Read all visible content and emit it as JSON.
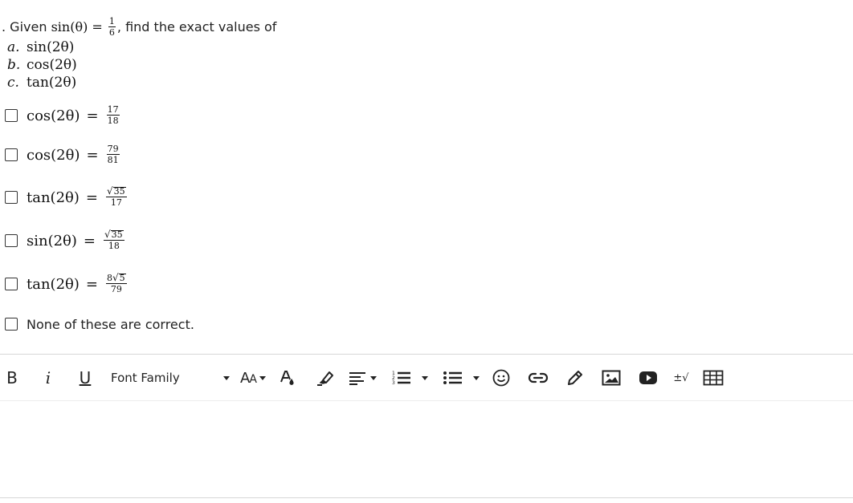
{
  "question": {
    "prefix": ". Given",
    "given_lhs": "sin(θ)",
    "given_eq": "=",
    "given_num": "1",
    "given_den": "6",
    "suffix": ", find the exact values of",
    "parts": [
      {
        "label": "a.",
        "expr": "sin(2θ)"
      },
      {
        "label": "b.",
        "expr": "cos(2θ)"
      },
      {
        "label": "c.",
        "expr": "tan(2θ)"
      }
    ]
  },
  "options": [
    {
      "lhs": "cos(2θ)",
      "eq": "=",
      "num_coef": "",
      "num_rad": "",
      "num": "17",
      "den": "18"
    },
    {
      "lhs": "cos(2θ)",
      "eq": "=",
      "num_coef": "",
      "num_rad": "",
      "num": "79",
      "den": "81"
    },
    {
      "lhs": "tan(2θ)",
      "eq": "=",
      "num_coef": "",
      "num_rad": "35",
      "num": "",
      "den": "17"
    },
    {
      "lhs": "sin(2θ)",
      "eq": "=",
      "num_coef": "",
      "num_rad": "35",
      "num": "",
      "den": "18"
    },
    {
      "lhs": "tan(2θ)",
      "eq": "=",
      "num_coef": "8",
      "num_rad": "5",
      "num": "",
      "den": "79"
    },
    {
      "text": "None of these are correct."
    }
  ],
  "toolbar": {
    "bold": "B",
    "italic": "i",
    "underline": "U",
    "font_family": "Font Family",
    "font_size_big": "A",
    "font_size_small": "A",
    "math": "±√",
    "icons": [
      "bold-icon",
      "italic-icon",
      "underline-icon",
      "font-size-icon",
      "text-color-icon",
      "highlight-icon",
      "align-icon",
      "ordered-list-icon",
      "unordered-list-icon",
      "emoji-icon",
      "link-icon",
      "draw-icon",
      "image-icon",
      "video-icon",
      "math-icon",
      "table-icon"
    ]
  },
  "editor": {
    "value": ""
  }
}
